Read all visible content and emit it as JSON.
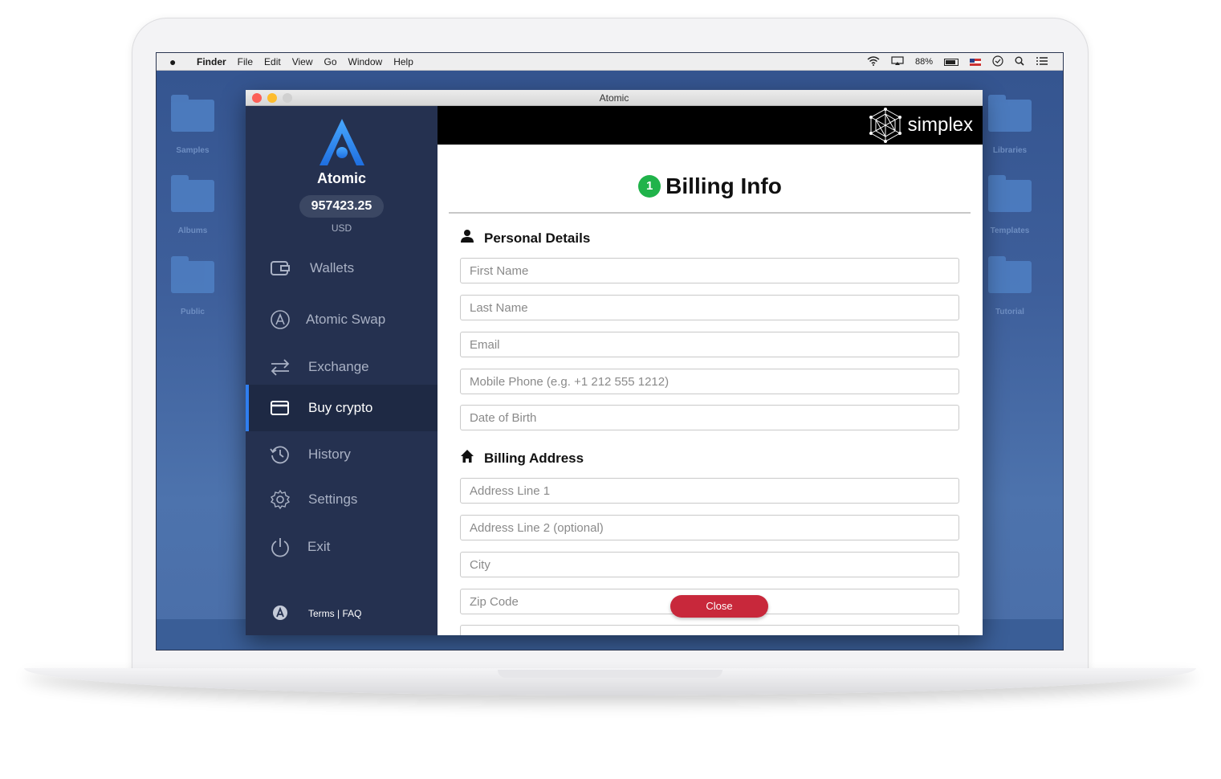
{
  "menubar": {
    "apple": "",
    "app": "Finder",
    "items": [
      "File",
      "Edit",
      "View",
      "Go",
      "Window",
      "Help"
    ],
    "battery_percent": "88%"
  },
  "desktop": {
    "left_icons": [
      "Samples",
      "Albums",
      "Public"
    ],
    "right_icons": [
      "Libraries",
      "Templates",
      "Tutorial"
    ]
  },
  "window": {
    "title": "Atomic"
  },
  "sidebar": {
    "brand": "Atomic",
    "balance": "957423.25",
    "currency": "USD",
    "items": [
      {
        "label": "Wallets",
        "icon": "wallet-icon"
      },
      {
        "label": "Atomic Swap",
        "icon": "atomic-swap-icon"
      },
      {
        "label": "Exchange",
        "icon": "exchange-arrows-icon"
      },
      {
        "label": "Buy crypto",
        "icon": "credit-card-icon",
        "active": true
      },
      {
        "label": "History",
        "icon": "history-clock-icon"
      },
      {
        "label": "Settings",
        "icon": "gear-icon"
      },
      {
        "label": "Exit",
        "icon": "power-icon"
      }
    ],
    "footer": "Terms | FAQ"
  },
  "main": {
    "brand": "simplex",
    "step": "1",
    "title": "Billing Info",
    "personal_heading": "Personal Details",
    "billing_heading": "Billing Address",
    "personal_fields": [
      "First Name",
      "Last Name",
      "Email",
      "Mobile Phone (e.g. +1 212 555 1212)",
      "Date of Birth"
    ],
    "address_fields": [
      "Address Line 1",
      "Address Line 2 (optional)",
      "City",
      "Zip Code"
    ],
    "close_label": "Close"
  },
  "colors": {
    "sidebar_bg": "#253150",
    "accent_blue": "#2f7ef0",
    "step_green": "#20b34a",
    "close_red": "#c8283b"
  }
}
